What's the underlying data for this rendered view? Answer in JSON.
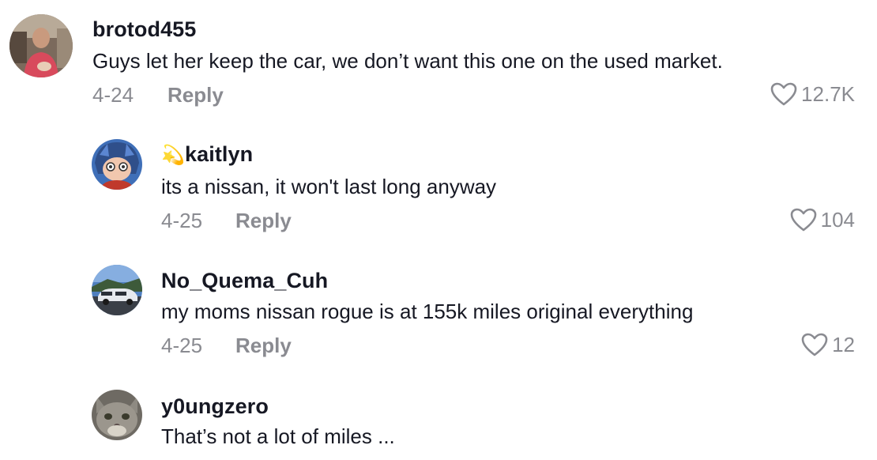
{
  "comments": [
    {
      "username": "brotod455",
      "text": "Guys let her keep the car, we don’t want this one on the used market.",
      "date": "4-24",
      "reply_label": "Reply",
      "likes": "12.7K",
      "avatar_icon": "user-avatar-photo"
    },
    {
      "username_emoji": "💫",
      "username": "kaitlyn",
      "text": "its a nissan, it won't last long anyway",
      "date": "4-25",
      "reply_label": "Reply",
      "likes": "104",
      "avatar_icon": "anime-avatar"
    },
    {
      "username": "No_Quema_Cuh",
      "text": "my moms nissan rogue is at 155k miles original everything",
      "date": "4-25",
      "reply_label": "Reply",
      "likes": "12",
      "avatar_icon": "car-avatar"
    },
    {
      "username": "y0ungzero",
      "text": "That’s not a lot of miles ...",
      "avatar_icon": "cat-avatar"
    }
  ],
  "colors": {
    "primary_text": "#161823",
    "secondary_text": "#8a8b91",
    "background": "#ffffff"
  },
  "icons": {
    "like": "heart-outline-icon"
  }
}
